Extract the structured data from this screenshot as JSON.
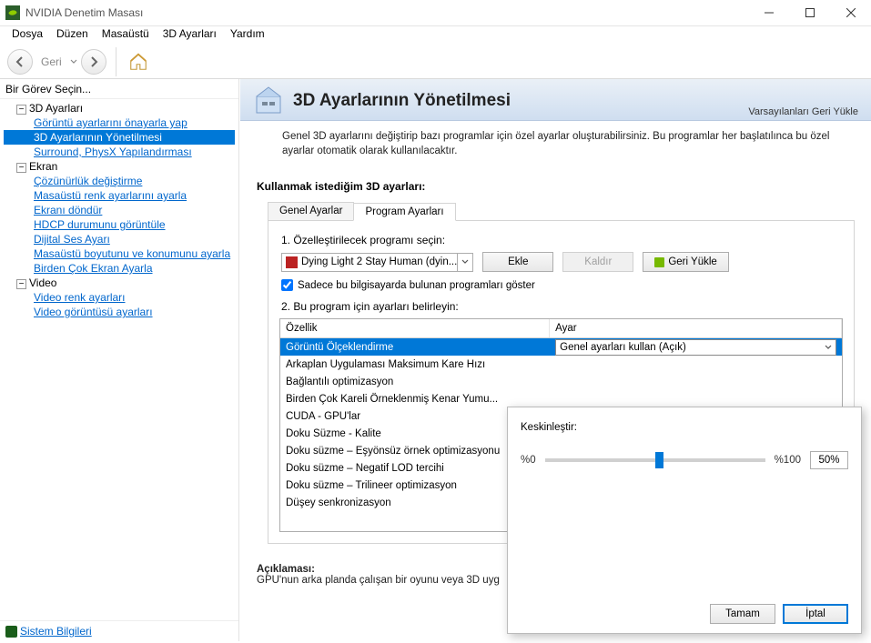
{
  "window": {
    "title": "NVIDIA Denetim Masası"
  },
  "menu": {
    "items": [
      "Dosya",
      "Düzen",
      "Masaüstü",
      "3D Ayarları",
      "Yardım"
    ]
  },
  "toolbar": {
    "back_label": "Geri"
  },
  "sidebar": {
    "header": "Bir Görev Seçin...",
    "groups": [
      {
        "label": "3D Ayarları",
        "items": [
          "Görüntü ayarlarını önayarla yap",
          "3D Ayarlarının Yönetilmesi",
          "Surround, PhysX Yapılandırması"
        ],
        "selected": 1
      },
      {
        "label": "Ekran",
        "items": [
          "Çözünürlük değiştirme",
          "Masaüstü renk ayarlarını ayarla",
          "Ekranı döndür",
          "HDCP durumunu görüntüle",
          "Dijital Ses Ayarı",
          "Masaüstü boyutunu ve konumunu ayarla",
          "Birden Çok Ekran Ayarla"
        ]
      },
      {
        "label": "Video",
        "items": [
          "Video renk ayarları",
          "Video görüntüsü ayarları"
        ]
      }
    ],
    "footer_link": "Sistem Bilgileri"
  },
  "main": {
    "title": "3D Ayarlarının Yönetilmesi",
    "restore_defaults": "Varsayılanları Geri Yükle",
    "intro": "Genel 3D ayarlarını değiştirip bazı programlar için özel ayarlar oluşturabilirsiniz. Bu programlar her başlatılınca bu özel ayarlar otomatik olarak kullanılacaktır.",
    "section_heading": "Kullanmak istediğim 3D ayarları:",
    "tabs": [
      "Genel Ayarlar",
      "Program Ayarları"
    ],
    "active_tab": 1,
    "step1_label": "1. Özelleştirilecek programı seçin:",
    "program_dropdown": "Dying Light 2 Stay Human (dyin...",
    "btn_add": "Ekle",
    "btn_remove": "Kaldır",
    "btn_restore": "Geri Yükle",
    "checkbox_label": "Sadece bu bilgisayarda bulunan programları göster",
    "checkbox_checked": true,
    "step2_label": "2. Bu program için ayarları belirleyin:",
    "table": {
      "col1": "Özellik",
      "col2": "Ayar",
      "rows": [
        {
          "name": "Görüntü Ölçeklendirme",
          "value": "Genel ayarları kullan (Açık)",
          "selected": true
        },
        {
          "name": "Arkaplan Uygulaması Maksimum Kare Hızı",
          "value": ""
        },
        {
          "name": "Bağlantılı optimizasyon",
          "value": ""
        },
        {
          "name": "Birden Çok Kareli Örneklenmiş Kenar Yumu...",
          "value": ""
        },
        {
          "name": "CUDA - GPU'lar",
          "value": ""
        },
        {
          "name": "Doku Süzme - Kalite",
          "value": ""
        },
        {
          "name": "Doku süzme – Eşyönsüz örnek optimizasyonu",
          "value": ""
        },
        {
          "name": "Doku süzme – Negatif LOD tercihi",
          "value": ""
        },
        {
          "name": "Doku süzme – Trilineer optimizasyon",
          "value": ""
        },
        {
          "name": "Düşey senkronizasyon",
          "value": ""
        }
      ]
    },
    "explain_heading": "Açıklaması:",
    "explain_text": "GPU'nun arka planda çalışan bir oyunu veya 3D uyg"
  },
  "popup": {
    "label": "Keskinleştir:",
    "min": "%0",
    "max": "%100",
    "value": "50%",
    "ok": "Tamam",
    "cancel": "İptal"
  }
}
